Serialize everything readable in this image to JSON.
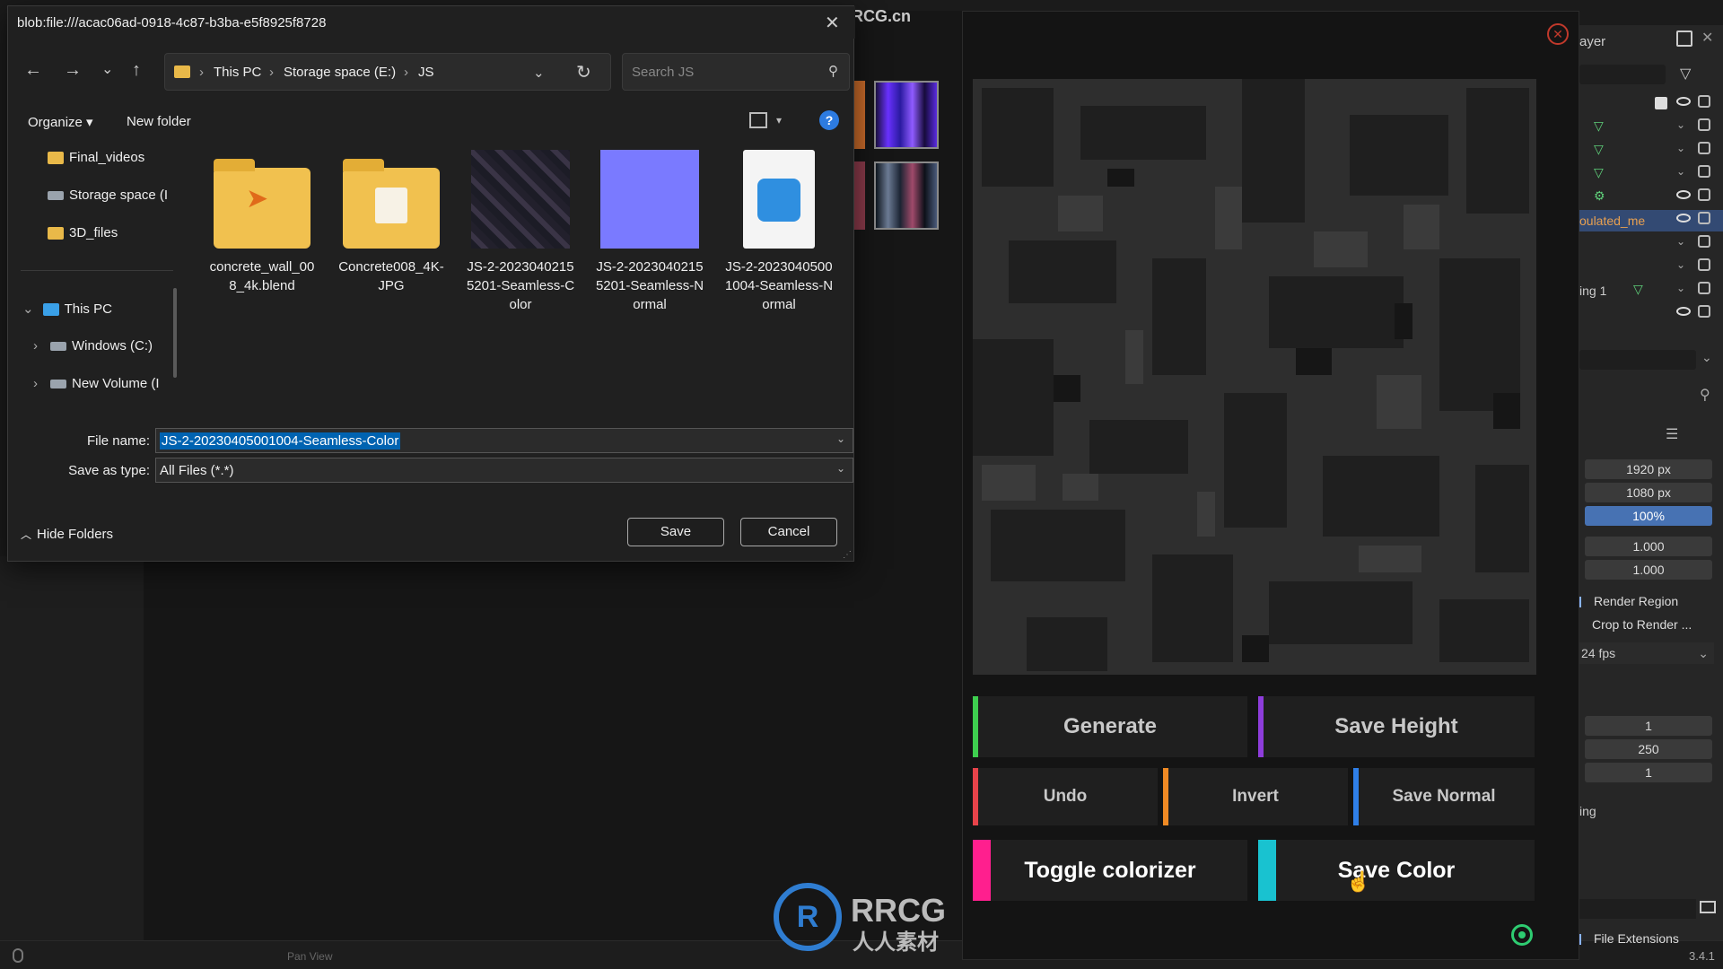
{
  "dialog": {
    "title": "blob:file:///acac06ad-0918-4c87-b3ba-e5f8925f8728",
    "nav": {
      "back_icon": "←",
      "forward_icon": "→",
      "recent_icon": "⌄",
      "up_icon": "↑",
      "refresh_icon": "↻"
    },
    "address": {
      "crumbs": [
        "This PC",
        "Storage space (E:)",
        "JS"
      ]
    },
    "search_placeholder": "Search JS",
    "toolbar": {
      "organize": "Organize",
      "new_folder": "New folder",
      "help": "?"
    },
    "nav_pane": [
      "Final_videos",
      "Storage space (I",
      "3D_files",
      "This PC",
      "Windows (C:)",
      "New Volume (I"
    ],
    "files": [
      {
        "name": "concrete_wall_008_4k.blend",
        "l1": "concrete_wall_00",
        "l2": "8_4k.blend",
        "l3": "",
        "kind": "blend-folder"
      },
      {
        "name": "Concrete008_4K-JPG",
        "l1": "Concrete008_4K-",
        "l2": "JPG",
        "l3": "",
        "kind": "folder"
      },
      {
        "name": "JS-2-20230402155201-Seamless-Color",
        "l1": "JS-2-2023040215",
        "l2": "5201-Seamless-C",
        "l3": "olor",
        "kind": "texture"
      },
      {
        "name": "JS-2-20230402155201-Seamless-Normal",
        "l1": "JS-2-2023040215",
        "l2": "5201-Seamless-N",
        "l3": "ormal",
        "kind": "normal"
      },
      {
        "name": "JS-2-20230405001004-Seamless-Normal",
        "l1": "JS-2-2023040500",
        "l2": "1004-Seamless-N",
        "l3": "ormal",
        "kind": "image"
      }
    ],
    "file_name_label": "File name:",
    "file_name_value": "JS-2-20230405001004-Seamless-Color",
    "save_type_label": "Save as type:",
    "save_type_value": "All Files (*.*)",
    "save_button": "Save",
    "cancel_button": "Cancel",
    "hide_folders": "Hide Folders"
  },
  "generator": {
    "buttons": {
      "generate": "Generate",
      "save_height": "Save Height",
      "undo": "Undo",
      "invert": "Invert",
      "save_normal": "Save Normal",
      "toggle_colorizer": "Toggle colorizer",
      "save_color": "Save Color"
    },
    "colors": {
      "generate": "#3ecf4f",
      "save_height": "#8e3ddb",
      "undo": "#e8434a",
      "invert": "#f08a24",
      "save_normal": "#2f7fe8",
      "toggle_colorizer": "#ff1f8e",
      "save_color": "#19c2d0"
    }
  },
  "blender": {
    "top_text": "ayer",
    "outliner_selected": "oulated_me",
    "outliner_label2": "ing 1",
    "resolution_x": "1920 px",
    "resolution_y": "1080 px",
    "resolution_pct": "100%",
    "aspect_x": "1.000",
    "aspect_y": "1.000",
    "render_region": "Render Region",
    "crop_to_render": "Crop to Render ...",
    "fps": "24 fps",
    "frame_start": "1",
    "frame_end": "250",
    "frame_step": "1",
    "label_ing": "ing",
    "file_extensions": "File Extensions",
    "version": "3.4.1",
    "status_hint": "Pan View"
  },
  "watermark": {
    "site": "RRCG.cn",
    "logo": "RRCG",
    "sub": "人人素材"
  }
}
